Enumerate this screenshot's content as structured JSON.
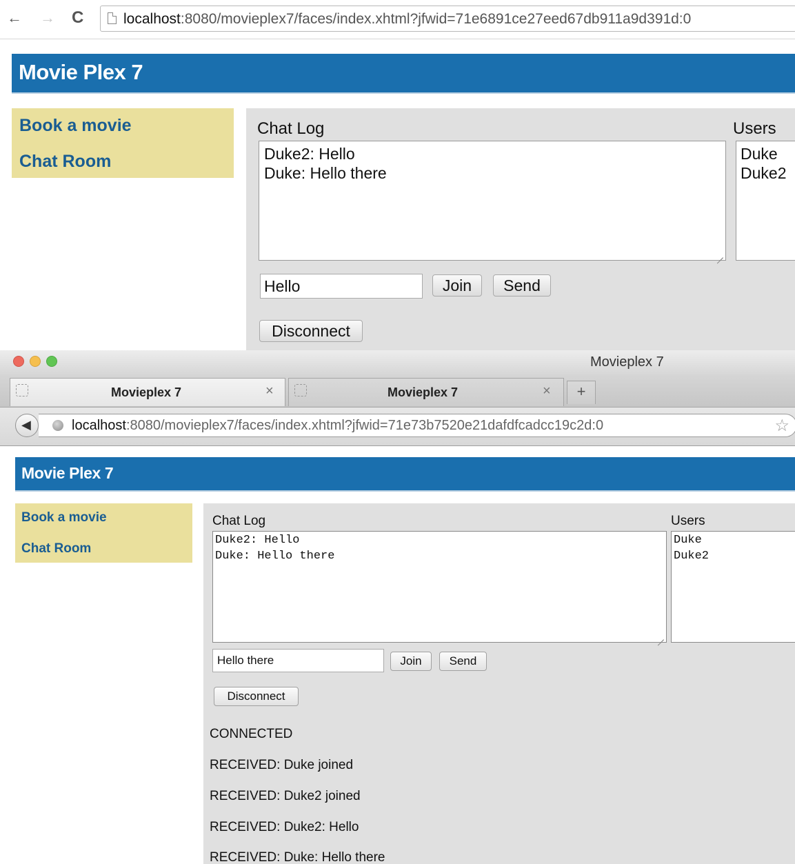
{
  "top_window": {
    "nav": {
      "back_icon": "←",
      "forward_icon": "→",
      "reload_icon": "C"
    },
    "url": {
      "host": "localhost",
      "path": ":8080/movieplex7/faces/index.xhtml?jfwid=71e6891ce27eed67db911a9d391d:0"
    },
    "banner_title": "Movie Plex 7",
    "sidebar": {
      "book_link": "Book a movie",
      "chat_link": "Chat Room"
    },
    "chat": {
      "log_label": "Chat Log",
      "users_label": "Users",
      "log_lines": [
        "Duke2: Hello",
        "Duke: Hello there"
      ],
      "users": [
        "Duke",
        "Duke2"
      ],
      "input_value": "Hello",
      "join_label": "Join",
      "send_label": "Send",
      "disconnect_label": "Disconnect"
    }
  },
  "bottom_window": {
    "window_title": "Movieplex 7",
    "tabs": [
      {
        "label": "Movieplex 7",
        "close_icon": "×"
      },
      {
        "label": "Movieplex 7",
        "close_icon": "×"
      }
    ],
    "new_tab_icon": "+",
    "back_icon": "◀",
    "star_icon": "☆",
    "url": {
      "host": "localhost",
      "path": ":8080/movieplex7/faces/index.xhtml?jfwid=71e73b7520e21dafdfcadcc19c2d:0"
    },
    "banner_title": "Movie Plex 7",
    "sidebar": {
      "book_link": "Book a movie",
      "chat_link": "Chat Room"
    },
    "chat": {
      "log_label": "Chat Log",
      "users_label": "Users",
      "log_lines": [
        "Duke2: Hello",
        "Duke: Hello there"
      ],
      "users": [
        "Duke",
        "Duke2"
      ],
      "input_value": "Hello there",
      "join_label": "Join",
      "send_label": "Send",
      "disconnect_label": "Disconnect"
    },
    "status_lines": [
      "CONNECTED",
      "RECEIVED: Duke joined",
      "RECEIVED: Duke2 joined",
      "RECEIVED: Duke2: Hello",
      "RECEIVED: Duke: Hello there"
    ]
  },
  "colors": {
    "banner": "#1a6fae",
    "sidebar": "#eae09d",
    "link": "#1a5d92",
    "panel": "#e0e0e0"
  }
}
